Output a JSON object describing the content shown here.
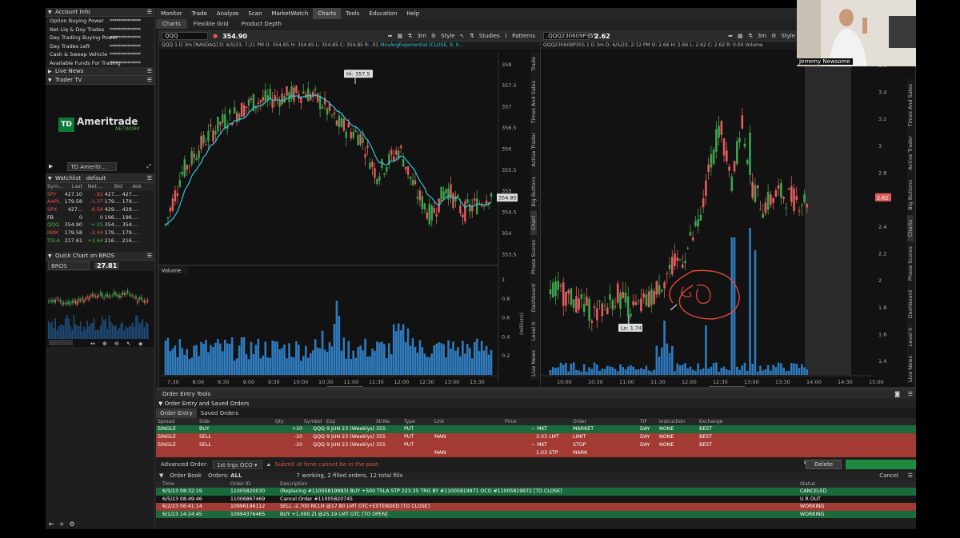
{
  "menubar": [
    "Monitor",
    "Trade",
    "Analyze",
    "Scan",
    "MarketWatch",
    "Charts",
    "Tools",
    "Education",
    "Help"
  ],
  "menubar_active": "Charts",
  "subtabs": [
    "Charts",
    "Flexible Grid",
    "Product Depth"
  ],
  "left": {
    "account_info": {
      "title": "Account Info",
      "rows": [
        {
          "label": "Option Buying Power",
          "value": "**************"
        },
        {
          "label": "Net Liq & Day Trades",
          "value": "**************"
        },
        {
          "label": "Day Trading Buying Power",
          "value": "**************"
        },
        {
          "label": "Day Trades Left",
          "value": "**************"
        },
        {
          "label": "Cash & Sweep Vehicle",
          "value": "**************"
        },
        {
          "label": "Available Funds For Trading",
          "value": "**************"
        }
      ]
    },
    "live_news": "Live News",
    "trader_tv": {
      "title": "Trader TV",
      "logo_td": "TD",
      "logo_name": "Ameritrade",
      "logo_sub": "NETWORK",
      "channel": "TD Ameritr..."
    },
    "watchlist": {
      "title": "Watchlist",
      "name": "default",
      "headers": [
        "Sym...",
        "Last",
        "Net ...",
        "Bid",
        "Ask"
      ],
      "rows": [
        {
          "sym": "SPY",
          "last": "427.10",
          "net": "-.82",
          "bid": "427....",
          "ask": "427....",
          "dir": "neg"
        },
        {
          "sym": "AAPL",
          "last": "179.58",
          "net": "-1.37",
          "bid": "179....",
          "ask": "179....",
          "dir": "neg"
        },
        {
          "sym": "SPX",
          "last": "427...",
          "net": "-8.58",
          "bid": "429....",
          "ask": "429....",
          "dir": "neg"
        },
        {
          "sym": "FB",
          "last": "0",
          "net": "0",
          "bid": "196....",
          "ask": "196....",
          "dir": "zero"
        },
        {
          "sym": "QQQ",
          "last": "354.90",
          "net": "+.25",
          "bid": "354....",
          "ask": "354....",
          "dir": "pos"
        },
        {
          "sym": "IWM",
          "last": "179.58",
          "net": "-2.44",
          "bid": "179....",
          "ask": "179....",
          "dir": "neg"
        },
        {
          "sym": "TSLA",
          "last": "217.61",
          "net": "+3.64",
          "bid": "216....",
          "ask": "216....",
          "dir": "pos"
        }
      ]
    },
    "quick_chart": {
      "title": "Quick Chart on BROS",
      "symbol": "BROS",
      "price": "27.81"
    }
  },
  "chart_left": {
    "symbol": "QQQ",
    "last": "354.90",
    "info": "QQQ 1 D 3m [NASDAQ]  D: 6/5/23, 7:21 PM  O: 354.85  H: 354.85  L: 354.85  C: 354.85  R: .01",
    "ma": "MovAvgExponential (CLOSE, 9, 0...",
    "hi_label": "Hi: 357.5",
    "price_label": "354.85",
    "yticks": [
      "358",
      "357.5",
      "357",
      "356.5",
      "356",
      "355.5",
      "355",
      "354.5",
      "354",
      "353.5"
    ],
    "xticks": [
      "7:30",
      "8:00",
      "8:30",
      "9:00",
      "9:30",
      "10:00",
      "10:30",
      "11:00",
      "11:30",
      "12:00",
      "12:30",
      "13:00",
      "13:30"
    ],
    "volume_label": "Volume",
    "vol_yticks": [
      "1",
      "0.8",
      "0.6",
      "0.4",
      "0.2"
    ],
    "vol_unit": "(millions)",
    "drawing_set": "Drawing set: Default",
    "side_tabs": [
      "Trade",
      "Times And Sales",
      "Active Trader",
      "Big Buttons",
      "Chart",
      "Phase Scores",
      "Dashboard",
      "Level II",
      "Live News"
    ]
  },
  "chart_right": {
    "symbol": ".QQQ230609P355",
    "last": "2.62",
    "info": "QQQ230609P355 1 D 3m  D: 6/5/23, 2:12 PM  O: 2.66  H: 2.66  L: 2.62  C: 2.62  R: 0.04  Volume",
    "lo_label": "Lo: 1.74",
    "price_label": "2.62",
    "yticks": [
      "3.6",
      "3.4",
      "3.2",
      "3",
      "2.8",
      "2.6",
      "2.4",
      "2.2",
      "2",
      "1.8",
      "1.6",
      "1.4"
    ],
    "xticks": [
      "10:00",
      "10:30",
      "11:00",
      "11:30",
      "12:00",
      "12:30",
      "13:00",
      "13:30",
      "14:00",
      "14:30",
      "15:00"
    ],
    "drawing_set": "Drawing set: Default",
    "side_tabs": [
      "Times And Sales",
      "Active Trader",
      "Big Buttons",
      "Charts",
      "Phase Scores",
      "Dashboard",
      "Level II",
      "Live News"
    ]
  },
  "toolbar_labels": {
    "style": "Style",
    "studies": "Studies",
    "patterns": "Patterns",
    "tf": "3m"
  },
  "order_entry": {
    "title": "Order Entry Tools",
    "sub": "Order Entry and Saved Orders",
    "tabs": [
      "Order Entry",
      "Saved Orders"
    ],
    "headers": [
      "Spread",
      "Side",
      "",
      "Qty",
      "Symbol",
      "Exp",
      "Strike",
      "Type",
      "Link",
      "Price",
      "",
      "Order",
      "",
      "TIF",
      "Instruction",
      "Exchange"
    ],
    "rows": [
      {
        "cls": "g",
        "spread": "SINGLE",
        "side": "BUY",
        "qty": "+10",
        "sym": "QQQ",
        "exp": "9 JUN 23 (Weeklys)",
        "strike": "355",
        "type": "PUT",
        "link": "",
        "price": "~ MKT",
        "ptype": "",
        "order": "MARKET",
        "tif": "DAY",
        "ins": "NONE",
        "exch": "BEST"
      },
      {
        "cls": "r",
        "spread": "SINGLE",
        "side": "SELL",
        "qty": "-10",
        "sym": "QQQ",
        "exp": "9 JUN 23 (Weeklys)",
        "strike": "355",
        "type": "PUT",
        "link": "MAN",
        "price": "3.03",
        "ptype": "LMT",
        "order": "LIMIT",
        "tif": "DAY",
        "ins": "NONE",
        "exch": "BEST"
      },
      {
        "cls": "r",
        "spread": "SINGLE",
        "side": "SELL",
        "qty": "-10",
        "sym": "QQQ",
        "exp": "9 JUN 23 (Weeklys)",
        "strike": "355",
        "type": "PUT",
        "link": "",
        "price": "~ MKT",
        "ptype": "",
        "order": "STOP",
        "tif": "DAY",
        "ins": "NONE",
        "exch": "BEST"
      },
      {
        "cls": "r",
        "spread": "",
        "side": "",
        "qty": "",
        "sym": "",
        "exp": "",
        "strike": "",
        "type": "",
        "link": "MAN",
        "price": "1.03",
        "ptype": "STP",
        "order": "MARK",
        "tif": "",
        "ins": "",
        "exch": ""
      }
    ],
    "advanced_label": "Advanced Order:",
    "advanced_value": "1st trgs OCO",
    "warning": "Submit at time cannot be in the past",
    "delete": "Delete"
  },
  "order_book": {
    "title": "Order Book",
    "orders_label": "Orders:",
    "orders_value": "ALL",
    "summary": "7 working, 2 filled orders, 12 total fills",
    "cancel": "Cancel",
    "headers": [
      "Time",
      "Order ID",
      "Description",
      "Status"
    ],
    "rows": [
      {
        "cls": "g",
        "time": "6/5/23 08:32:19",
        "id": "11005820030",
        "desc": "(Replacing #11005819983) BUY +500 TSLA STP 223.35 TRG BY #11005819971 OCO #11005819972 [TO CLOSE]",
        "status": "CANCELED"
      },
      {
        "cls": "k",
        "time": "6/5/23 08:49:46",
        "id": "11006867469",
        "desc": "Cancel Order #11005820745",
        "status": "U R OUT"
      },
      {
        "cls": "r",
        "time": "6/2/23 06:41:14",
        "id": "10996196112",
        "desc": "SELL -2,700 NCLH @17.80 LMT GTC+EXTENDED [TO CLOSE]",
        "status": "WORKING"
      },
      {
        "cls": "g",
        "time": "6/1/23 14:24:45",
        "id": "10994376465",
        "desc": "BUY +1,000 ZI @25.19 LMT GTC [TO OPEN]",
        "status": "WORKING"
      }
    ]
  },
  "webcam": {
    "name": "Jerremy Newsome"
  }
}
